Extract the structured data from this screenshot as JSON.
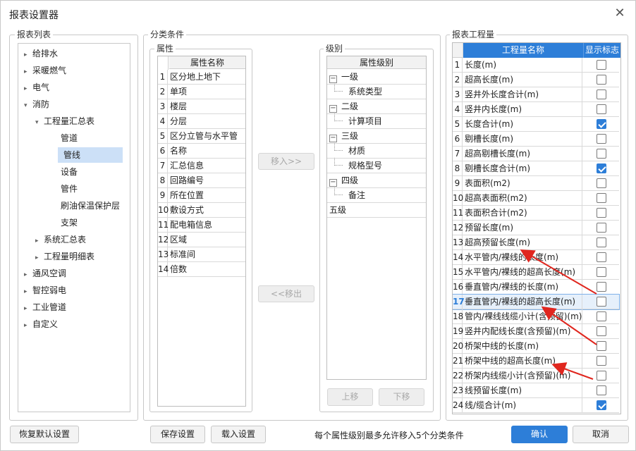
{
  "window": {
    "title": "报表设置器",
    "close_icon": "close-icon"
  },
  "groups": {
    "report_list": "报表列表",
    "category_cond": "分类条件",
    "attr": "属性",
    "level": "级别",
    "quantity": "报表工程量"
  },
  "tree": [
    {
      "label": "给排水",
      "arrow": "▸"
    },
    {
      "label": "采暖燃气",
      "arrow": "▸"
    },
    {
      "label": "电气",
      "arrow": "▸"
    },
    {
      "label": "消防",
      "arrow": "▾"
    },
    {
      "label": "工程量汇总表",
      "arrow": "▾"
    },
    {
      "label": "管道",
      "arrow": ""
    },
    {
      "label": "管线",
      "arrow": ""
    },
    {
      "label": "设备",
      "arrow": ""
    },
    {
      "label": "管件",
      "arrow": ""
    },
    {
      "label": "刷油保温保护层",
      "arrow": ""
    },
    {
      "label": "支架",
      "arrow": ""
    },
    {
      "label": "系统汇总表",
      "arrow": "▸"
    },
    {
      "label": "工程量明细表",
      "arrow": "▸"
    },
    {
      "label": "通风空调",
      "arrow": "▸"
    },
    {
      "label": "智控弱电",
      "arrow": "▸"
    },
    {
      "label": "工业管道",
      "arrow": "▸"
    },
    {
      "label": "自定义",
      "arrow": "▸"
    }
  ],
  "attributes": {
    "header": "属性名称",
    "rows": [
      {
        "n": "1",
        "name": "区分地上地下"
      },
      {
        "n": "2",
        "name": "单项"
      },
      {
        "n": "3",
        "name": "楼层"
      },
      {
        "n": "4",
        "name": "分层"
      },
      {
        "n": "5",
        "name": "区分立管与水平管"
      },
      {
        "n": "6",
        "name": "名称"
      },
      {
        "n": "7",
        "name": "汇总信息"
      },
      {
        "n": "8",
        "name": "回路编号"
      },
      {
        "n": "9",
        "name": "所在位置"
      },
      {
        "n": "10",
        "name": "敷设方式"
      },
      {
        "n": "11",
        "name": "配电箱信息"
      },
      {
        "n": "12",
        "name": "区域"
      },
      {
        "n": "13",
        "name": "标准间"
      },
      {
        "n": "14",
        "name": "倍数"
      }
    ]
  },
  "move_in": "移入>>",
  "move_out": "<<移出",
  "levels": {
    "header": "属性级别",
    "rows": [
      {
        "label": "一级",
        "toggle": "−"
      },
      {
        "label": "系统类型",
        "toggle": ""
      },
      {
        "label": "二级",
        "toggle": "−"
      },
      {
        "label": "计算项目",
        "toggle": ""
      },
      {
        "label": "三级",
        "toggle": "−"
      },
      {
        "label": "材质",
        "toggle": ""
      },
      {
        "label": "规格型号",
        "toggle": ""
      },
      {
        "label": "四级",
        "toggle": "−"
      },
      {
        "label": "备注",
        "toggle": ""
      },
      {
        "label": "五级",
        "toggle": ""
      }
    ]
  },
  "move_up": "上移",
  "move_down": "下移",
  "quantity": {
    "col_name": "工程量名称",
    "col_flag": "显示标志",
    "rows": [
      {
        "n": "1",
        "name": "长度(m)",
        "checked": false
      },
      {
        "n": "2",
        "name": "超高长度(m)",
        "checked": false
      },
      {
        "n": "3",
        "name": "竖井外长度合计(m)",
        "checked": false
      },
      {
        "n": "4",
        "name": "竖井内长度(m)",
        "checked": false
      },
      {
        "n": "5",
        "name": "长度合计(m)",
        "checked": true
      },
      {
        "n": "6",
        "name": "剔槽长度(m)",
        "checked": false
      },
      {
        "n": "7",
        "name": "超高剔槽长度(m)",
        "checked": false
      },
      {
        "n": "8",
        "name": "剔槽长度合计(m)",
        "checked": true
      },
      {
        "n": "9",
        "name": "表面积(m2)",
        "checked": false
      },
      {
        "n": "10",
        "name": "超高表面积(m2)",
        "checked": false
      },
      {
        "n": "11",
        "name": "表面积合计(m2)",
        "checked": false
      },
      {
        "n": "12",
        "name": "预留长度(m)",
        "checked": false
      },
      {
        "n": "13",
        "name": "超高预留长度(m)",
        "checked": false
      },
      {
        "n": "14",
        "name": "水平管内/裸线的长度(m)",
        "checked": false
      },
      {
        "n": "15",
        "name": "水平管内/裸线的超高长度(m)",
        "checked": false
      },
      {
        "n": "16",
        "name": "垂直管内/裸线的长度(m)",
        "checked": false
      },
      {
        "n": "17",
        "name": "垂直管内/裸线的超高长度(m)",
        "checked": false
      },
      {
        "n": "18",
        "name": "管内/裸线线缆小计(含预留)(m)",
        "checked": false
      },
      {
        "n": "19",
        "name": "竖井内配线长度(含预留)(m)",
        "checked": false
      },
      {
        "n": "20",
        "name": "桥架中线的长度(m)",
        "checked": false
      },
      {
        "n": "21",
        "name": "桥架中线的超高长度(m)",
        "checked": false
      },
      {
        "n": "22",
        "name": "桥架内线缆小计(含预留)(m)",
        "checked": false
      },
      {
        "n": "23",
        "name": "线预留长度(m)",
        "checked": false
      },
      {
        "n": "24",
        "name": "线/缆合计(m)",
        "checked": true
      }
    ]
  },
  "footer": {
    "restore": "恢复默认设置",
    "save": "保存设置",
    "load": "载入设置",
    "note": "每个属性级别最多允许移入5个分类条件",
    "ok": "确认",
    "cancel": "取消"
  },
  "colors": {
    "accent": "#2d7ed8",
    "selection": "#cce0f7",
    "annotation_arrow": "#e0261e"
  }
}
